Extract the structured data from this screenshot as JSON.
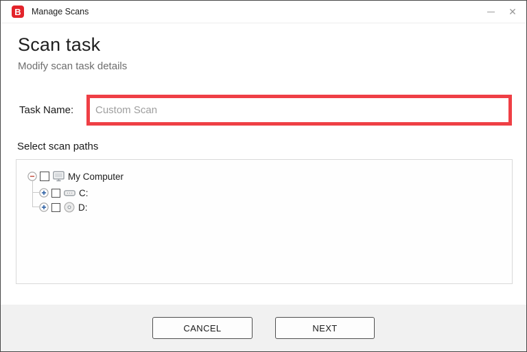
{
  "titlebar": {
    "logo_letter": "B",
    "title": "Manage Scans",
    "minimize_icon": "minimize-dash",
    "close_glyph": "✕"
  },
  "header": {
    "title": "Scan task",
    "subtitle": "Modify scan task details"
  },
  "form": {
    "task_name_label": "Task Name:",
    "task_name_value": "",
    "task_name_placeholder": "Custom Scan",
    "highlight_color": "#ef3f45"
  },
  "paths": {
    "section_label": "Select scan paths",
    "tree": {
      "items": [
        {
          "label": "My Computer",
          "icon": "computer-icon",
          "expanded": true,
          "checked": false
        },
        {
          "label": "C:",
          "icon": "hdd-icon",
          "expanded": false,
          "checked": false
        },
        {
          "label": "D:",
          "icon": "disc-icon",
          "expanded": false,
          "checked": false
        }
      ]
    }
  },
  "footer": {
    "cancel_label": "CANCEL",
    "next_label": "NEXT"
  },
  "colors": {
    "brand_red": "#e3242b",
    "highlight_red": "#ef3f45",
    "footer_bg": "#f1f1f1",
    "expander_plus_blue": "#2b5fa3",
    "expander_minus_red": "#c75b4e"
  }
}
